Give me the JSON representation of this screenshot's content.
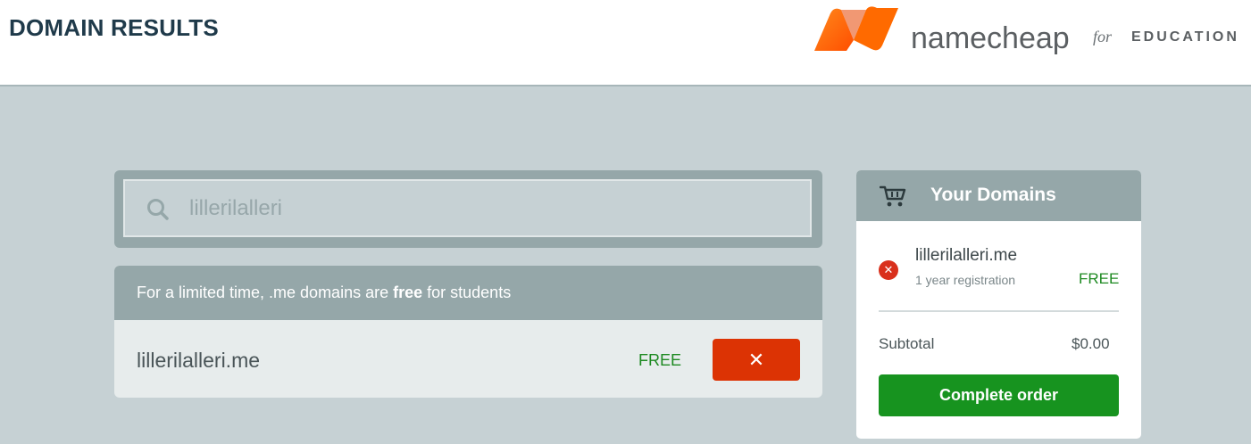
{
  "header": {
    "title": "DOMAIN RESULTS",
    "logo": {
      "brand": "namecheap",
      "for": "for",
      "product": "EDUCATION",
      "colors": [
        "#ff5000",
        "#ff8c1a"
      ]
    }
  },
  "search": {
    "value": "lillerilalleri",
    "icon": "search-icon"
  },
  "promo": {
    "prefix": "For a limited time, .me domains are ",
    "highlight": "free",
    "suffix": " for students"
  },
  "result": {
    "domain": "lillerilalleri.me",
    "price": "FREE",
    "remove_label": "✕"
  },
  "cart": {
    "title": "Your Domains",
    "icon": "cart-icon",
    "items": [
      {
        "domain": "lillerilalleri.me",
        "term": "1 year registration",
        "price": "FREE",
        "remove_label": "✕"
      }
    ],
    "subtotal_label": "Subtotal",
    "subtotal_value": "$0.00",
    "complete_label": "Complete order"
  },
  "colors": {
    "background": "#c6d1d4",
    "panel": "#95a7a9",
    "remove": "#dc3304",
    "free": "#1e8a22",
    "complete": "#17931f",
    "title": "#1f3a4a"
  }
}
